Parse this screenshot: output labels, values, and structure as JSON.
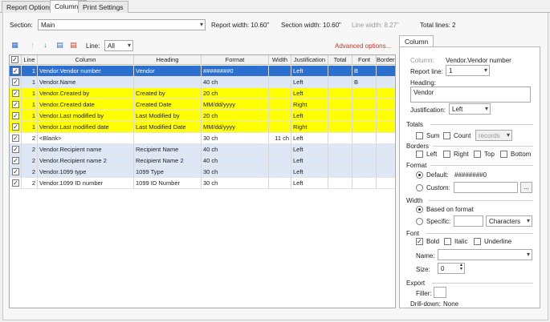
{
  "tabs": [
    "Report Options",
    "Columns",
    "Print Settings"
  ],
  "section": {
    "label": "Section:",
    "value": "Main"
  },
  "report_width": "Report width: 10.60\"",
  "section_width": "Section width: 10.60\"",
  "line_width": "Line width: 8.27\"",
  "total_lines": "Total lines: 2",
  "toolbar": {
    "line_label": "Line:",
    "line_value": "All",
    "advanced": "Advanced options..."
  },
  "grid": {
    "headers": [
      "Line",
      "Column",
      "Heading",
      "Format",
      "Width",
      "Justification",
      "Total",
      "Font",
      "Borders"
    ],
    "rows": [
      {
        "line": "1",
        "column": "Vendor.Vendor number",
        "heading": "Vendor",
        "format": "########0",
        "width": "",
        "just": "Left",
        "total": "",
        "font": "B",
        "borders": ""
      },
      {
        "line": "1",
        "column": "Vendor.Name",
        "heading": "",
        "format": "40 ch",
        "width": "",
        "just": "Left",
        "total": "",
        "font": "B",
        "borders": ""
      },
      {
        "line": "1",
        "column": "Vendor.Created by",
        "heading": "Created by",
        "format": "20 ch",
        "width": "",
        "just": "Left",
        "total": "",
        "font": "",
        "borders": ""
      },
      {
        "line": "1",
        "column": "Vendor.Created date",
        "heading": "Created Date",
        "format": "MM/dd/yyyy",
        "width": "",
        "just": "Right",
        "total": "",
        "font": "",
        "borders": ""
      },
      {
        "line": "1",
        "column": "Vendor.Last modified by",
        "heading": "Last Modified by",
        "format": "20 ch",
        "width": "",
        "just": "Left",
        "total": "",
        "font": "",
        "borders": ""
      },
      {
        "line": "1",
        "column": "Vendor.Last modified date",
        "heading": "Last Modified Date",
        "format": "MM/dd/yyyy",
        "width": "",
        "just": "Right",
        "total": "",
        "font": "",
        "borders": ""
      },
      {
        "line": "2",
        "column": "<Blank>",
        "heading": "",
        "format": "30 ch",
        "width": "11 ch",
        "just": "Left",
        "total": "",
        "font": "",
        "borders": ""
      },
      {
        "line": "2",
        "column": "Vendor.Recipient name",
        "heading": "Recipient Name",
        "format": "40 ch",
        "width": "",
        "just": "Left",
        "total": "",
        "font": "",
        "borders": ""
      },
      {
        "line": "2",
        "column": "Vendor.Recipient name 2",
        "heading": "Recipient Name 2",
        "format": "40 ch",
        "width": "",
        "just": "Left",
        "total": "",
        "font": "",
        "borders": ""
      },
      {
        "line": "2",
        "column": "Vendor.1099 type",
        "heading": "1099 Type",
        "format": "30 ch",
        "width": "",
        "just": "Left",
        "total": "",
        "font": "",
        "borders": ""
      },
      {
        "line": "2",
        "column": "Vendor.1099 ID number",
        "heading": "1099 ID Number",
        "format": "30 ch",
        "width": "",
        "just": "Left",
        "total": "",
        "font": "",
        "borders": ""
      }
    ]
  },
  "panel": {
    "tab": "Column",
    "column_label": "Column:",
    "column_value": "Vendor.Vendor number",
    "report_line_label": "Report line:",
    "report_line_value": "1",
    "heading_label": "Heading:",
    "heading_value": "Vendor",
    "justification_label": "Justification:",
    "justification_value": "Left",
    "totals_label": "Totals",
    "sum": "Sum",
    "count": "Count",
    "records": "records",
    "borders_label": "Borders",
    "left": "Left",
    "right": "Right",
    "top": "Top",
    "bottom": "Bottom",
    "format_label": "Format",
    "default_label": "Default:",
    "default_value": "########0",
    "custom_label": "Custom:",
    "custom_btn": "...",
    "width_label": "Width",
    "based_on_format": "Based on format",
    "specific_label": "Specific:",
    "characters": "Characters",
    "font_label": "Font",
    "bold": "Bold",
    "italic": "Italic",
    "underline": "Underline",
    "name_label": "Name:",
    "size_label": "Size:",
    "size_value": "0",
    "export_label": "Export",
    "filler_label": "Filler:",
    "drilldown_label": "Drill-down:",
    "drilldown_value": "None"
  }
}
